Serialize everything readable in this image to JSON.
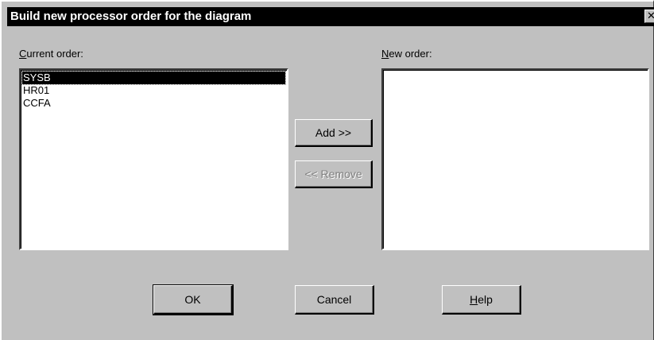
{
  "dialog": {
    "title": "Build new processor order for the diagram",
    "close_glyph": "✕"
  },
  "current_order": {
    "label_accel": "C",
    "label_rest": "urrent order:",
    "items": [
      "SYSB",
      "HR01",
      "CCFA"
    ],
    "selected_index": 0
  },
  "new_order": {
    "label_accel": "N",
    "label_rest": "ew order:",
    "items": []
  },
  "buttons": {
    "add": "Add >>",
    "remove": "<< Remove",
    "ok": "OK",
    "cancel": "Cancel",
    "help_accel": "H",
    "help_rest": "elp"
  },
  "colors": {
    "face": "#c0c0c0",
    "titlebar": "#000000",
    "selection": "#000000",
    "disabled_text": "#808080"
  },
  "icons": {
    "close": "close-icon"
  }
}
